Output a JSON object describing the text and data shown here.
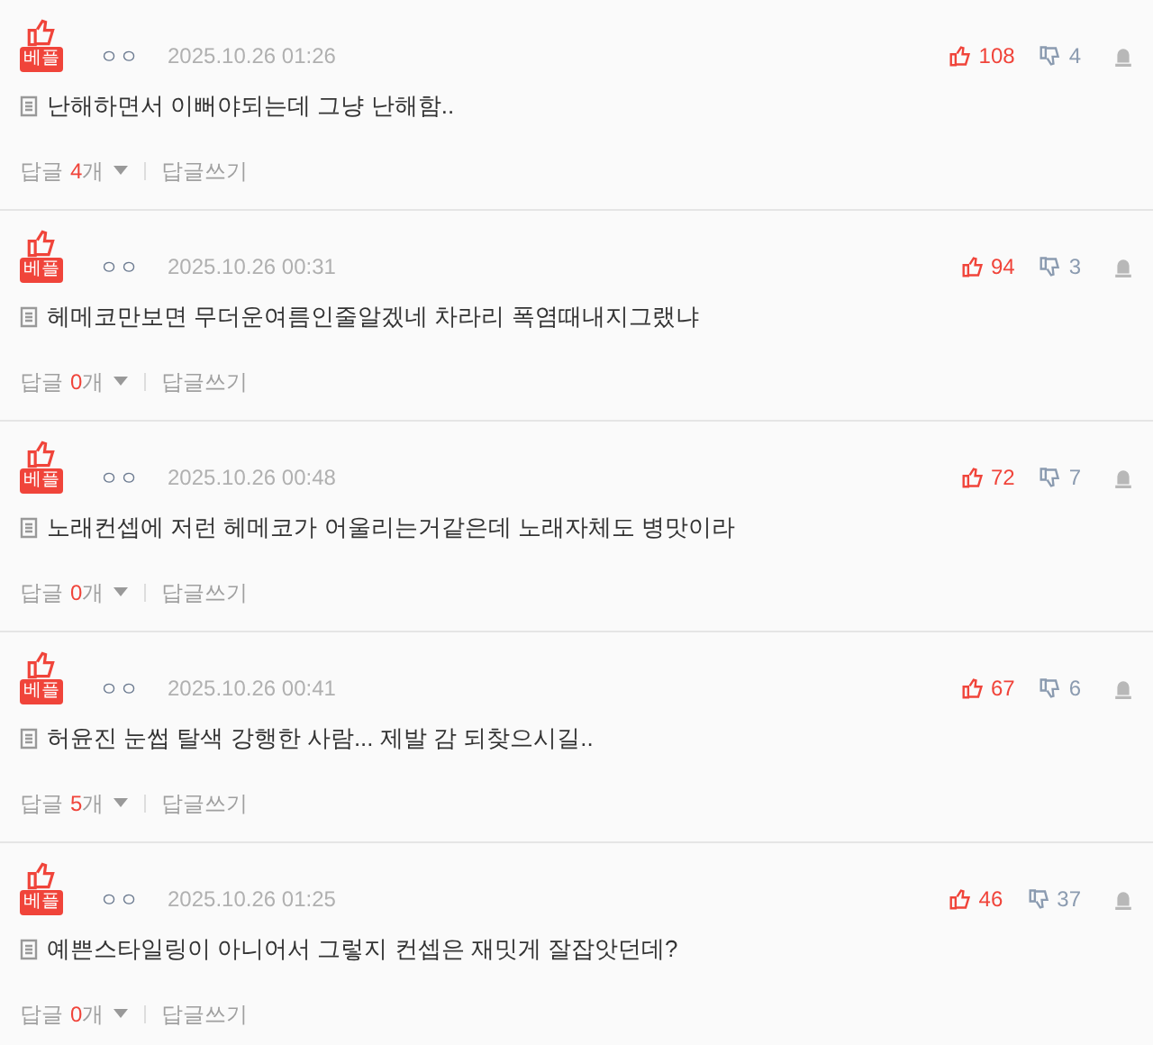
{
  "comments": [
    {
      "badge": "베플",
      "nickname": "ㅇㅇ",
      "date": "2025.10.26 01:26",
      "likes": "108",
      "dislikes": "4",
      "text": "난해하면서 이뻐야되는데 그냥 난해함..",
      "reply_label": "답글",
      "reply_count": "4",
      "reply_unit": "개",
      "write_reply": "답글쓰기"
    },
    {
      "badge": "베플",
      "nickname": "ㅇㅇ",
      "date": "2025.10.26 00:31",
      "likes": "94",
      "dislikes": "3",
      "text": "헤메코만보면 무더운여름인줄알겠네 차라리 폭염때내지그랬냐",
      "reply_label": "답글",
      "reply_count": "0",
      "reply_unit": "개",
      "write_reply": "답글쓰기"
    },
    {
      "badge": "베플",
      "nickname": "ㅇㅇ",
      "date": "2025.10.26 00:48",
      "likes": "72",
      "dislikes": "7",
      "text": "노래컨셉에 저런 헤메코가 어울리는거같은데 노래자체도 병맛이라",
      "reply_label": "답글",
      "reply_count": "0",
      "reply_unit": "개",
      "write_reply": "답글쓰기"
    },
    {
      "badge": "베플",
      "nickname": "ㅇㅇ",
      "date": "2025.10.26 00:41",
      "likes": "67",
      "dislikes": "6",
      "text": "허윤진 눈썹 탈색 강행한 사람... 제발 감 되찾으시길..",
      "reply_label": "답글",
      "reply_count": "5",
      "reply_unit": "개",
      "write_reply": "답글쓰기"
    },
    {
      "badge": "베플",
      "nickname": "ㅇㅇ",
      "date": "2025.10.26 01:25",
      "likes": "46",
      "dislikes": "37",
      "text": "예쁜스타일링이 아니어서 그렇지 컨셉은 재밋게 잘잡앗던데?",
      "reply_label": "답글",
      "reply_count": "0",
      "reply_unit": "개",
      "write_reply": "답글쓰기"
    }
  ]
}
